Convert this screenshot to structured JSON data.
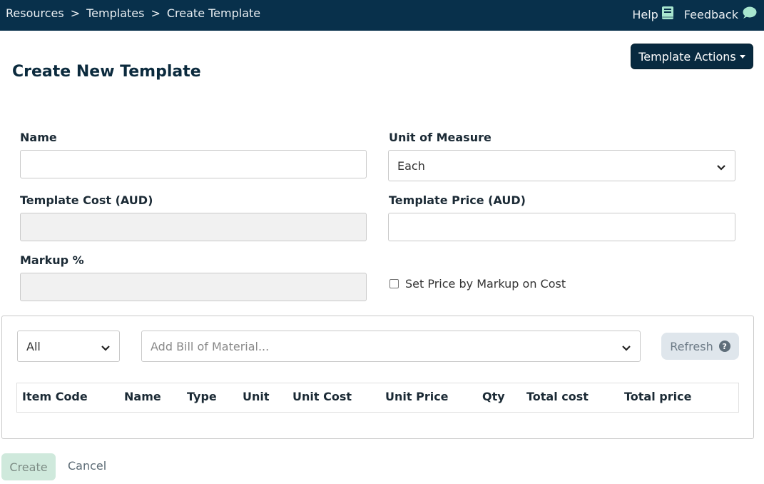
{
  "breadcrumb": {
    "items": [
      "Resources",
      "Templates",
      "Create Template"
    ],
    "separator": ">"
  },
  "topnav": {
    "help": "Help",
    "feedback": "Feedback",
    "help_icon": "book-icon",
    "feedback_icon": "speech-bubble-icon"
  },
  "header": {
    "title": "Create New Template",
    "actions_label": "Template Actions"
  },
  "form": {
    "name": {
      "label": "Name",
      "value": ""
    },
    "unit_of_measure": {
      "label": "Unit of Measure",
      "value": "Each"
    },
    "template_cost": {
      "label": "Template Cost (AUD)",
      "value": ""
    },
    "template_price": {
      "label": "Template Price (AUD)",
      "value": ""
    },
    "markup": {
      "label": "Markup %",
      "value": ""
    },
    "set_price_by_markup": {
      "label": "Set Price by Markup on Cost",
      "checked": false
    }
  },
  "bom": {
    "filter_value": "All",
    "add_placeholder": "Add Bill of Material...",
    "refresh_label": "Refresh",
    "columns": [
      "Item Code",
      "Name",
      "Type",
      "Unit",
      "Unit Cost",
      "Unit Price",
      "Qty",
      "Total cost",
      "Total price"
    ]
  },
  "footer": {
    "create_label": "Create",
    "cancel_label": "Cancel"
  },
  "colors": {
    "nav_bg": "#08304b",
    "accent_dark": "#082a40",
    "create_bg": "#cfe9dc",
    "refresh_bg": "#dfe6ec",
    "feedback_icon": "#a8e6cf",
    "help_icon": "#a8e6cf"
  }
}
